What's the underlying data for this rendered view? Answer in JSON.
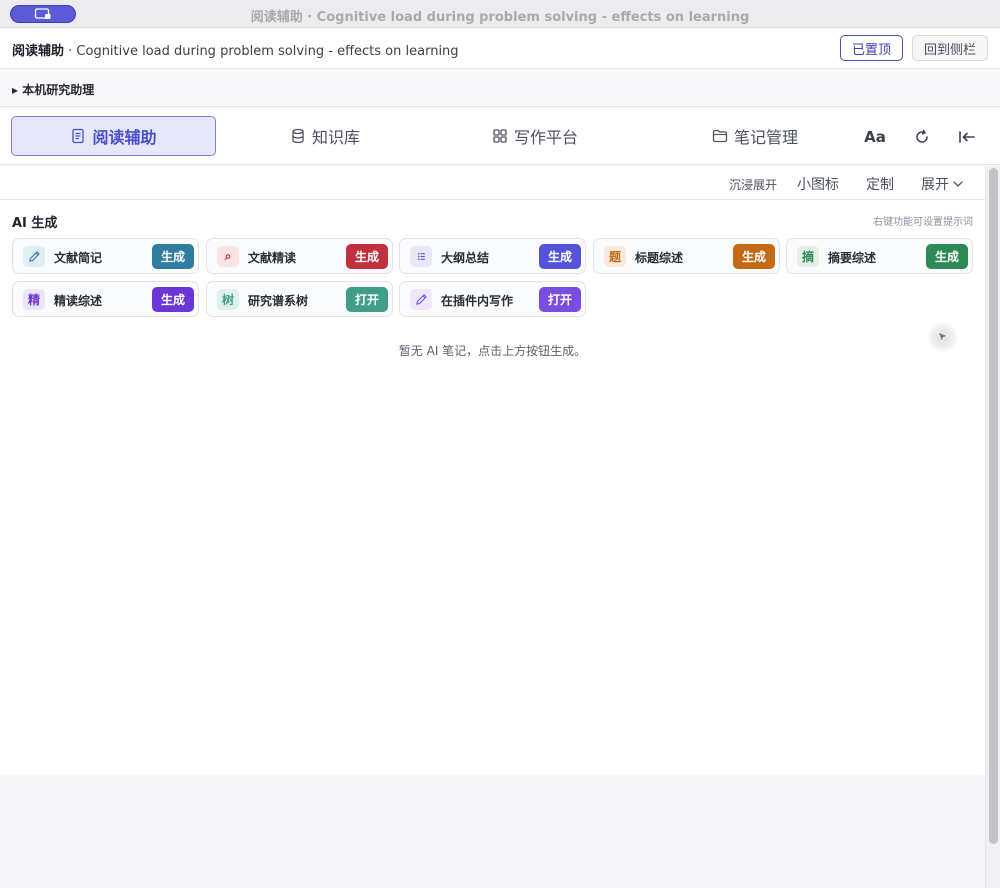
{
  "window": {
    "title": "阅读辅助 · Cognitive load during problem solving - effects on learning"
  },
  "header": {
    "title_bold": "阅读辅助",
    "title_rest": " · Cognitive load during problem solving - effects on learning",
    "pinned_label": "已置顶",
    "back_label": "回到侧栏"
  },
  "assistant": {
    "label": "▸ 本机研究助理"
  },
  "tabs": [
    {
      "label": "阅读辅助",
      "icon": "document-icon",
      "active": true
    },
    {
      "label": "知识库",
      "icon": "database-icon",
      "active": false
    },
    {
      "label": "写作平台",
      "icon": "grid-icon",
      "active": false
    },
    {
      "label": "笔记管理",
      "icon": "folder-icon",
      "active": false
    }
  ],
  "tools": {
    "font_label": "Aa",
    "refresh_icon": "refresh-icon",
    "collapse_icon": "collapse-left-icon"
  },
  "toolbar": {
    "immersive": "沉浸展开",
    "small_icons": "小图标",
    "customize": "定制",
    "expand": "展开"
  },
  "ai": {
    "title": "AI 生成",
    "hint": "右键功能可设置提示词",
    "cards": [
      {
        "label": "文献简记",
        "icon": "pencil-icon",
        "icon_text": "",
        "action": "生成",
        "color": "#2e7d9e",
        "icon_bg": "#e1eef5",
        "icon_fg": "#2e7d9e"
      },
      {
        "label": "文献精读",
        "icon": "magnifier-icon",
        "icon_text": "⌕",
        "action": "生成",
        "color": "#c0303e",
        "icon_bg": "#fbe4e7",
        "icon_fg": "#c0303e"
      },
      {
        "label": "大纲总结",
        "icon": "list-icon",
        "icon_text": "",
        "action": "生成",
        "color": "#5552d8",
        "icon_bg": "#e8e8f8",
        "icon_fg": "#5552d8"
      },
      {
        "label": "标题综述",
        "icon": "title-char-icon",
        "icon_text": "题",
        "action": "生成",
        "color": "#c46a16",
        "icon_bg": "#f8ebdc",
        "icon_fg": "#c46a16"
      },
      {
        "label": "摘要综述",
        "icon": "abstract-char-icon",
        "icon_text": "摘",
        "action": "生成",
        "color": "#2e8a55",
        "icon_bg": "#e2f0e7",
        "icon_fg": "#2e8a55"
      },
      {
        "label": "精读综述",
        "icon": "intensive-char-icon",
        "icon_text": "精",
        "action": "生成",
        "color": "#6a36d6",
        "icon_bg": "#ece4fa",
        "icon_fg": "#6a36d6"
      },
      {
        "label": "研究谱系树",
        "icon": "tree-char-icon",
        "icon_text": "树",
        "action": "打开",
        "color": "#3f9e8a",
        "icon_bg": "#e0f1ed",
        "icon_fg": "#3f9e8a"
      },
      {
        "label": "在插件内写作",
        "icon": "pencil-icon",
        "icon_text": "",
        "action": "打开",
        "color": "#7a4fe0",
        "icon_bg": "#efe8fb",
        "icon_fg": "#7a4fe0"
      }
    ],
    "empty_message": "暂无 AI 笔记，点击上方按钮生成。"
  }
}
